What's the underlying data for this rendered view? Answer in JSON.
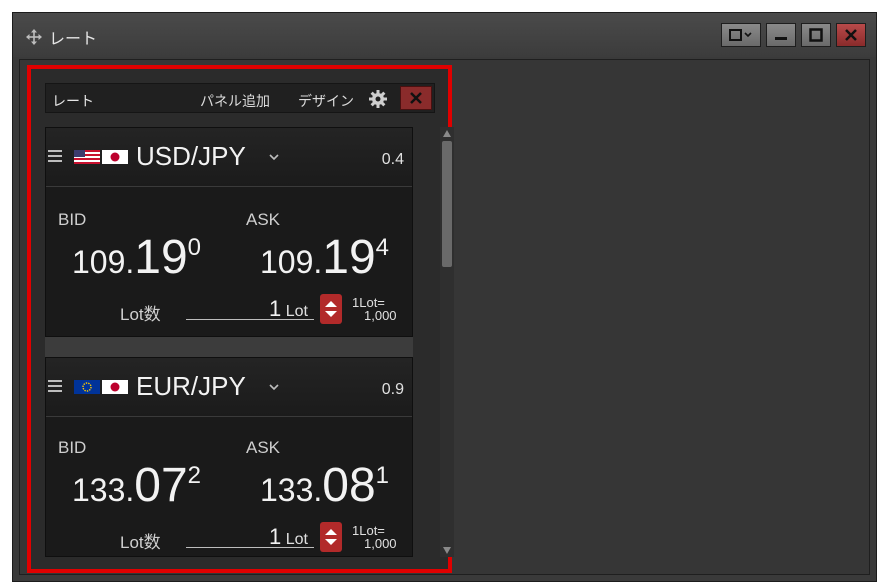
{
  "window": {
    "title": "レート",
    "controls": [
      "window-menu",
      "minimize",
      "maximize",
      "close"
    ]
  },
  "panel": {
    "title": "レート",
    "add_panel_label": "パネル追加",
    "design_label": "デザイン"
  },
  "rates": [
    {
      "pair": "USD/JPY",
      "flags": [
        "us",
        "jp"
      ],
      "spread": "0.4",
      "bid_label": "BID",
      "ask_label": "ASK",
      "bid": {
        "prefix": "109.",
        "big": "19",
        "sup": "0"
      },
      "ask": {
        "prefix": "109.",
        "big": "19",
        "sup": "4"
      },
      "lot_label": "Lot数",
      "lot_value": "1",
      "lot_unit": "Lot",
      "lot_size_line1": "1Lot=",
      "lot_size_line2": "1,000"
    },
    {
      "pair": "EUR/JPY",
      "flags": [
        "eu",
        "jp"
      ],
      "spread": "0.9",
      "bid_label": "BID",
      "ask_label": "ASK",
      "bid": {
        "prefix": "133.",
        "big": "07",
        "sup": "2"
      },
      "ask": {
        "prefix": "133.",
        "big": "08",
        "sup": "1"
      },
      "lot_label": "Lot数",
      "lot_value": "1",
      "lot_unit": "Lot",
      "lot_size_line1": "1Lot=",
      "lot_size_line2": "1,000"
    }
  ],
  "colors": {
    "highlight_border": "#e00000",
    "stepper": "#b22a2a",
    "close_button": "#8a2b2b"
  }
}
